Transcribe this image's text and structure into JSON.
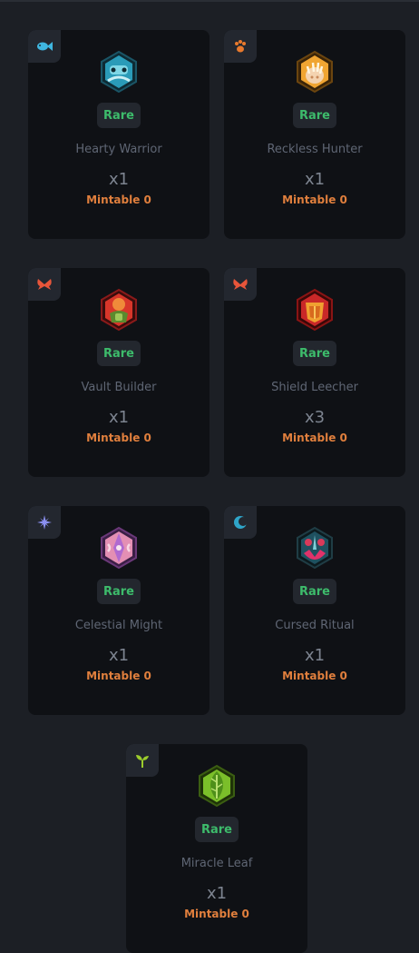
{
  "cards": [
    {
      "name": "Hearty Warrior",
      "rarity": "Rare",
      "qty": "x1",
      "mintable": "Mintable 0",
      "class_icon": "fish-icon",
      "class_color": "#3fb6e0",
      "emblem": "warrior-emblem",
      "emblem_color": "#2a9bb8"
    },
    {
      "name": "Reckless Hunter",
      "rarity": "Rare",
      "qty": "x1",
      "mintable": "Mintable 0",
      "class_icon": "paw-icon",
      "class_color": "#e8792d",
      "emblem": "hunter-emblem",
      "emblem_color": "#f0a532"
    },
    {
      "name": "Vault Builder",
      "rarity": "Rare",
      "qty": "x1",
      "mintable": "Mintable 0",
      "class_icon": "butterfly-icon",
      "class_color": "#e8553a",
      "emblem": "builder-emblem",
      "emblem_color": "#e0552b"
    },
    {
      "name": "Shield Leecher",
      "rarity": "Rare",
      "qty": "x3",
      "mintable": "Mintable 0",
      "class_icon": "butterfly-icon",
      "class_color": "#e8553a",
      "emblem": "leecher-emblem",
      "emblem_color": "#d8322c"
    },
    {
      "name": "Celestial Might",
      "rarity": "Rare",
      "qty": "x1",
      "mintable": "Mintable 0",
      "class_icon": "star-icon",
      "class_color": "#8a8ff0",
      "emblem": "might-emblem",
      "emblem_color": "#e38fb4"
    },
    {
      "name": "Cursed Ritual",
      "rarity": "Rare",
      "qty": "x1",
      "mintable": "Mintable 0",
      "class_icon": "moon-icon",
      "class_color": "#2fa5c9",
      "emblem": "ritual-emblem",
      "emblem_color": "#1f5160"
    },
    {
      "name": "Miracle Leaf",
      "rarity": "Rare",
      "qty": "x1",
      "mintable": "Mintable 0",
      "class_icon": "sprout-icon",
      "class_color": "#9ccc2c",
      "emblem": "leaf-emblem",
      "emblem_color": "#7bbf2a"
    }
  ]
}
